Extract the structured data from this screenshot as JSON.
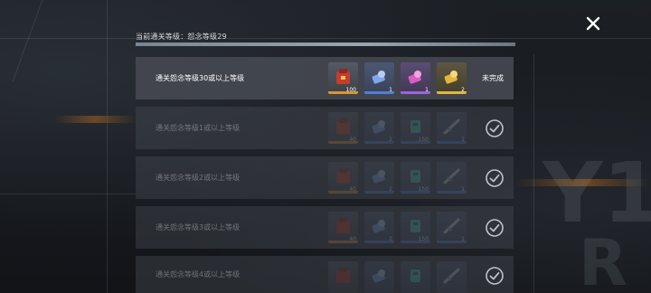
{
  "header": {
    "title": "当前通关等级：怨念等级29"
  },
  "close_icon": "close-icon",
  "rows": [
    {
      "label": "通关怨念等级30或以上等级",
      "status": "incomplete",
      "status_text": "未完成",
      "rewards": [
        {
          "icon": "red-crate-icon",
          "quality": "orange",
          "qty": "100"
        },
        {
          "icon": "blue-gear-icon",
          "quality": "blue",
          "qty": "1"
        },
        {
          "icon": "purple-gear-icon",
          "quality": "purple",
          "qty": "1"
        },
        {
          "icon": "gold-gear-icon",
          "quality": "gold",
          "qty": "2"
        }
      ]
    },
    {
      "label": "通关怨念等级1或以上等级",
      "status": "completed",
      "rewards": [
        {
          "icon": "red-crate-icon",
          "quality": "orange",
          "qty": "40"
        },
        {
          "icon": "blue-gear-icon",
          "quality": "blue",
          "qty": "2"
        },
        {
          "icon": "teal-module-icon",
          "quality": "blue",
          "qty": "150"
        },
        {
          "icon": "weapon-icon",
          "quality": "blue",
          "qty": "1"
        }
      ]
    },
    {
      "label": "通关怨念等级2或以上等级",
      "status": "completed",
      "rewards": [
        {
          "icon": "red-crate-icon",
          "quality": "orange",
          "qty": "40"
        },
        {
          "icon": "blue-gear-icon",
          "quality": "blue",
          "qty": "2"
        },
        {
          "icon": "teal-module-icon",
          "quality": "blue",
          "qty": "150"
        },
        {
          "icon": "weapon-icon",
          "quality": "blue",
          "qty": "1"
        }
      ]
    },
    {
      "label": "通关怨念等级3或以上等级",
      "status": "completed",
      "rewards": [
        {
          "icon": "red-crate-icon",
          "quality": "orange",
          "qty": "40"
        },
        {
          "icon": "blue-gear-icon",
          "quality": "blue",
          "qty": "2"
        },
        {
          "icon": "teal-module-icon",
          "quality": "blue",
          "qty": "150"
        },
        {
          "icon": "weapon-icon",
          "quality": "blue",
          "qty": "1"
        }
      ]
    },
    {
      "label": "通关怨念等级4或以上等级",
      "status": "completed",
      "rewards": [
        {
          "icon": "red-crate-icon",
          "quality": "orange",
          "qty": ""
        },
        {
          "icon": "blue-gear-icon",
          "quality": "blue",
          "qty": ""
        },
        {
          "icon": "teal-module-icon",
          "quality": "blue",
          "qty": ""
        },
        {
          "icon": "weapon-icon",
          "quality": "blue",
          "qty": ""
        }
      ]
    }
  ],
  "colors": {
    "orange": "#d9962e",
    "blue": "#4e7fd8",
    "purple": "#9b64da",
    "gold": "#e0b640",
    "check": "#d8dce2"
  }
}
